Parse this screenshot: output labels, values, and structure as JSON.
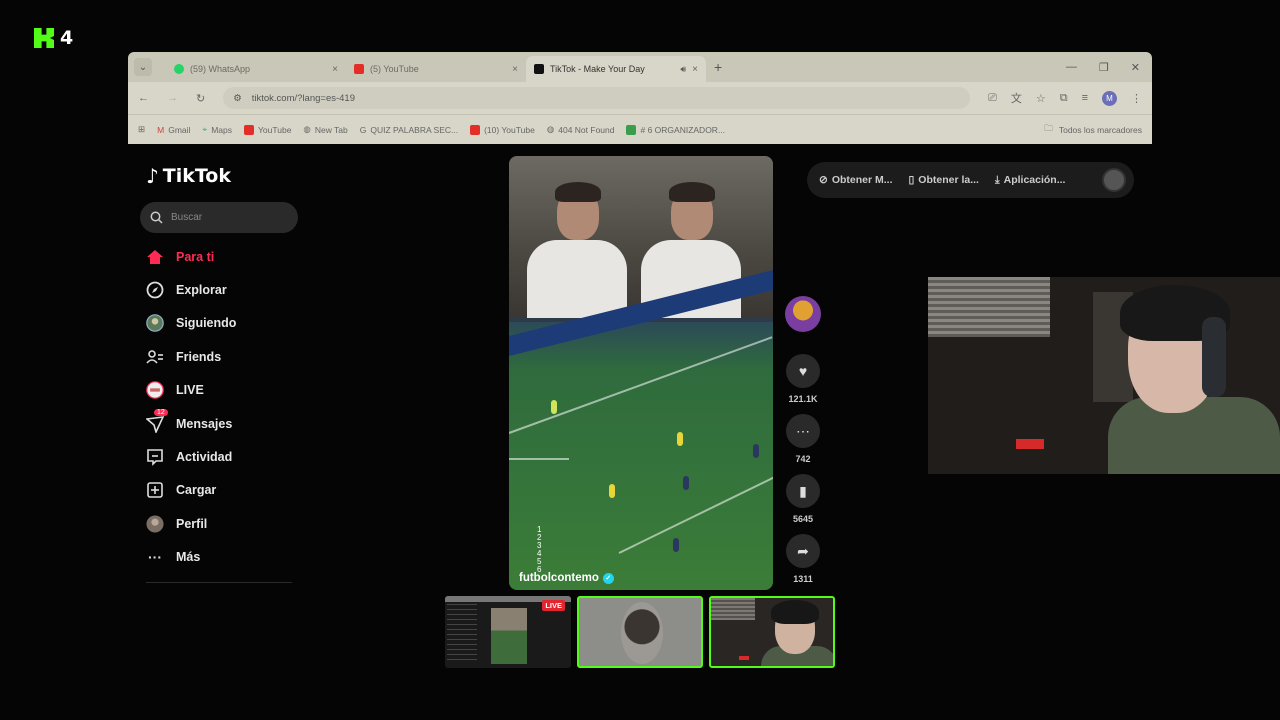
{
  "overlay": {
    "logo_text": "4",
    "logo_color": "#53fc18"
  },
  "browser": {
    "tabs": [
      {
        "title": "(59) WhatsApp",
        "favicon_color": "#25d366",
        "close": "×"
      },
      {
        "title": "(5) YouTube",
        "favicon_color": "#ff0000",
        "close": "×"
      },
      {
        "title": "TikTok - Make Your Day",
        "favicon_color": "#111111",
        "close": "×",
        "active": true
      }
    ],
    "new_tab": "+",
    "url": "tiktok.com/?lang=es-419",
    "profile_initial": "M",
    "bookmarks": [
      "Gmail",
      "Maps",
      "YouTube",
      "New Tab",
      "QUIZ PALABRA SEC...",
      "(10) YouTube",
      "404 Not Found",
      "# 6 ORGANIZADOR..."
    ],
    "bookmarks_all": "Todos los marcadores"
  },
  "tiktok": {
    "brand": "TikTok",
    "search_placeholder": "Buscar",
    "nav": [
      {
        "label": "Para ti",
        "icon": "home-icon",
        "active": true
      },
      {
        "label": "Explorar",
        "icon": "compass-icon"
      },
      {
        "label": "Siguiendo",
        "icon": "following-avatar-icon"
      },
      {
        "label": "Friends",
        "icon": "friends-icon"
      },
      {
        "label": "LIVE",
        "icon": "live-icon"
      },
      {
        "label": "Mensajes",
        "icon": "messages-icon",
        "badge": "12"
      },
      {
        "label": "Actividad",
        "icon": "activity-icon"
      },
      {
        "label": "Cargar",
        "icon": "upload-icon"
      },
      {
        "label": "Perfil",
        "icon": "profile-avatar-icon"
      },
      {
        "label": "Más",
        "icon": "more-icon"
      }
    ],
    "top_actions": [
      "Obtener M...",
      "Obtener la...",
      "Aplicación..."
    ],
    "video": {
      "username": "futbolcontemo",
      "counter": [
        "1",
        "2",
        "3",
        "4",
        "5",
        "6"
      ]
    },
    "actions": {
      "likes": "121.1K",
      "comments": "742",
      "saves": "5645",
      "shares": "1311"
    }
  },
  "stream": {
    "live_label": "LIVE",
    "accent": "#53fc18"
  }
}
